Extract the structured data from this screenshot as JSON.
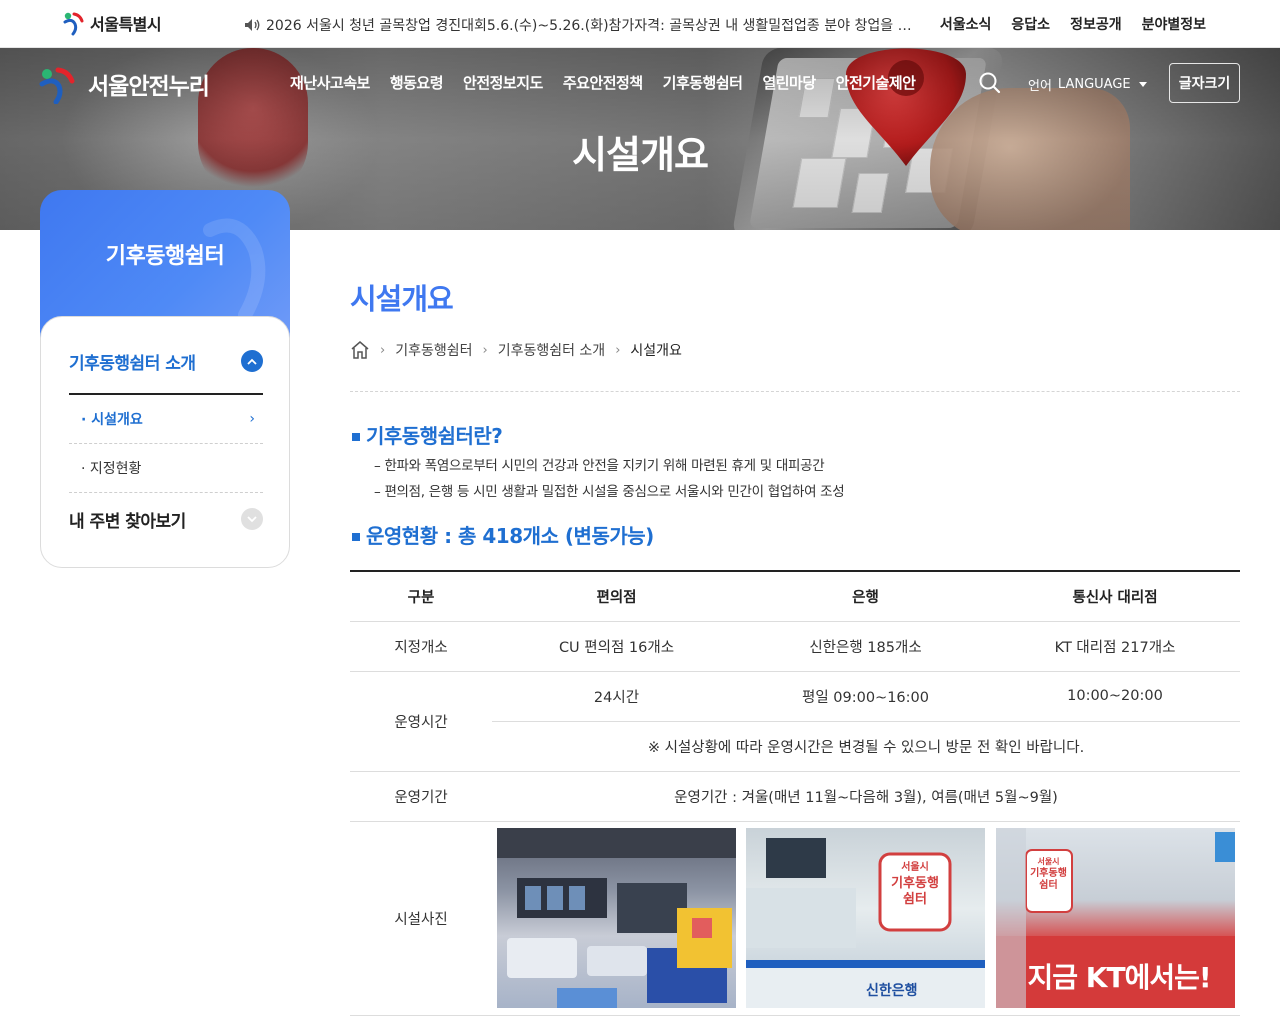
{
  "topbar": {
    "city_logo": "서울특별시",
    "notice": "2026 서울시 청년 골목창업 경진대회5.6.(수)~5.26.(화)참가자격: 골목상권 내 생활밀접업종 분야 창업을 준비하는",
    "links": [
      "서울소식",
      "응답소",
      "정보공개",
      "분야별정보"
    ]
  },
  "header": {
    "site_name": "서울안전누리",
    "nav": [
      "재난사고속보",
      "행동요령",
      "안전정보지도",
      "주요안전정책",
      "기후동행쉼터",
      "열린마당",
      "안전기술제안"
    ],
    "lang_ko": "언어",
    "lang_en": "LANGUAGE",
    "font_size": "글자크기",
    "hero_title": "시설개요"
  },
  "sidebar": {
    "title": "기후동행쉼터",
    "menu1": "기후동행쉼터 소개",
    "sub": [
      "· 시설개요",
      "· 지정현황"
    ],
    "menu2": "내 주변 찾아보기"
  },
  "content": {
    "page_title": "시설개요",
    "breadcrumb": [
      "기후동행쉼터",
      "기후동행쉼터 소개",
      "시설개요"
    ],
    "section1_title": "기후동행쉼터란?",
    "section1_lines": [
      "– 한파와 폭염으로부터 시민의 건강과 안전을 지키기 위해 마련된 휴게 및 대피공간",
      "– 편의점, 은행 등 시민 생활과 밀접한 시설을 중심으로 서울시와 민간이 협업하여 조성"
    ],
    "section2_title": "운영현황 : 총 418개소 (변동가능)",
    "table": {
      "headers": [
        "구분",
        "편의점",
        "은행",
        "통신사 대리점"
      ],
      "row_designated": [
        "지정개소",
        "CU 편의점 16개소",
        "신한은행 185개소",
        "KT 대리점 217개소"
      ],
      "row_hours_label": "운영시간",
      "row_hours": [
        "24시간",
        "평일 09:00~16:00",
        "10:00~20:00"
      ],
      "row_hours_note": "※ 시설상황에 따라 운영시간은 변경될 수 있으니 방문 전 확인 바랍니다.",
      "row_period_label": "운영기간",
      "row_period": "운영기간 : 겨울(매년 11월~다음해 3월), 여름(매년 5월~9월)",
      "row_photo_label": "시설사진",
      "photo_texts": {
        "bank_sign": [
          "서울시",
          "기후동행",
          "쉼터"
        ],
        "bank_name": "신한은행",
        "kt_sign": [
          "서울시",
          "기후동행",
          "쉼터"
        ],
        "kt_banner": "지금 KT에서는!"
      }
    }
  },
  "colors": {
    "primary_blue": "#1f6fd1",
    "title_blue": "#3f78f0",
    "seoul_red": "#e2242b",
    "seoul_green": "#2bb673",
    "seoul_blue": "#1f5fbf"
  }
}
